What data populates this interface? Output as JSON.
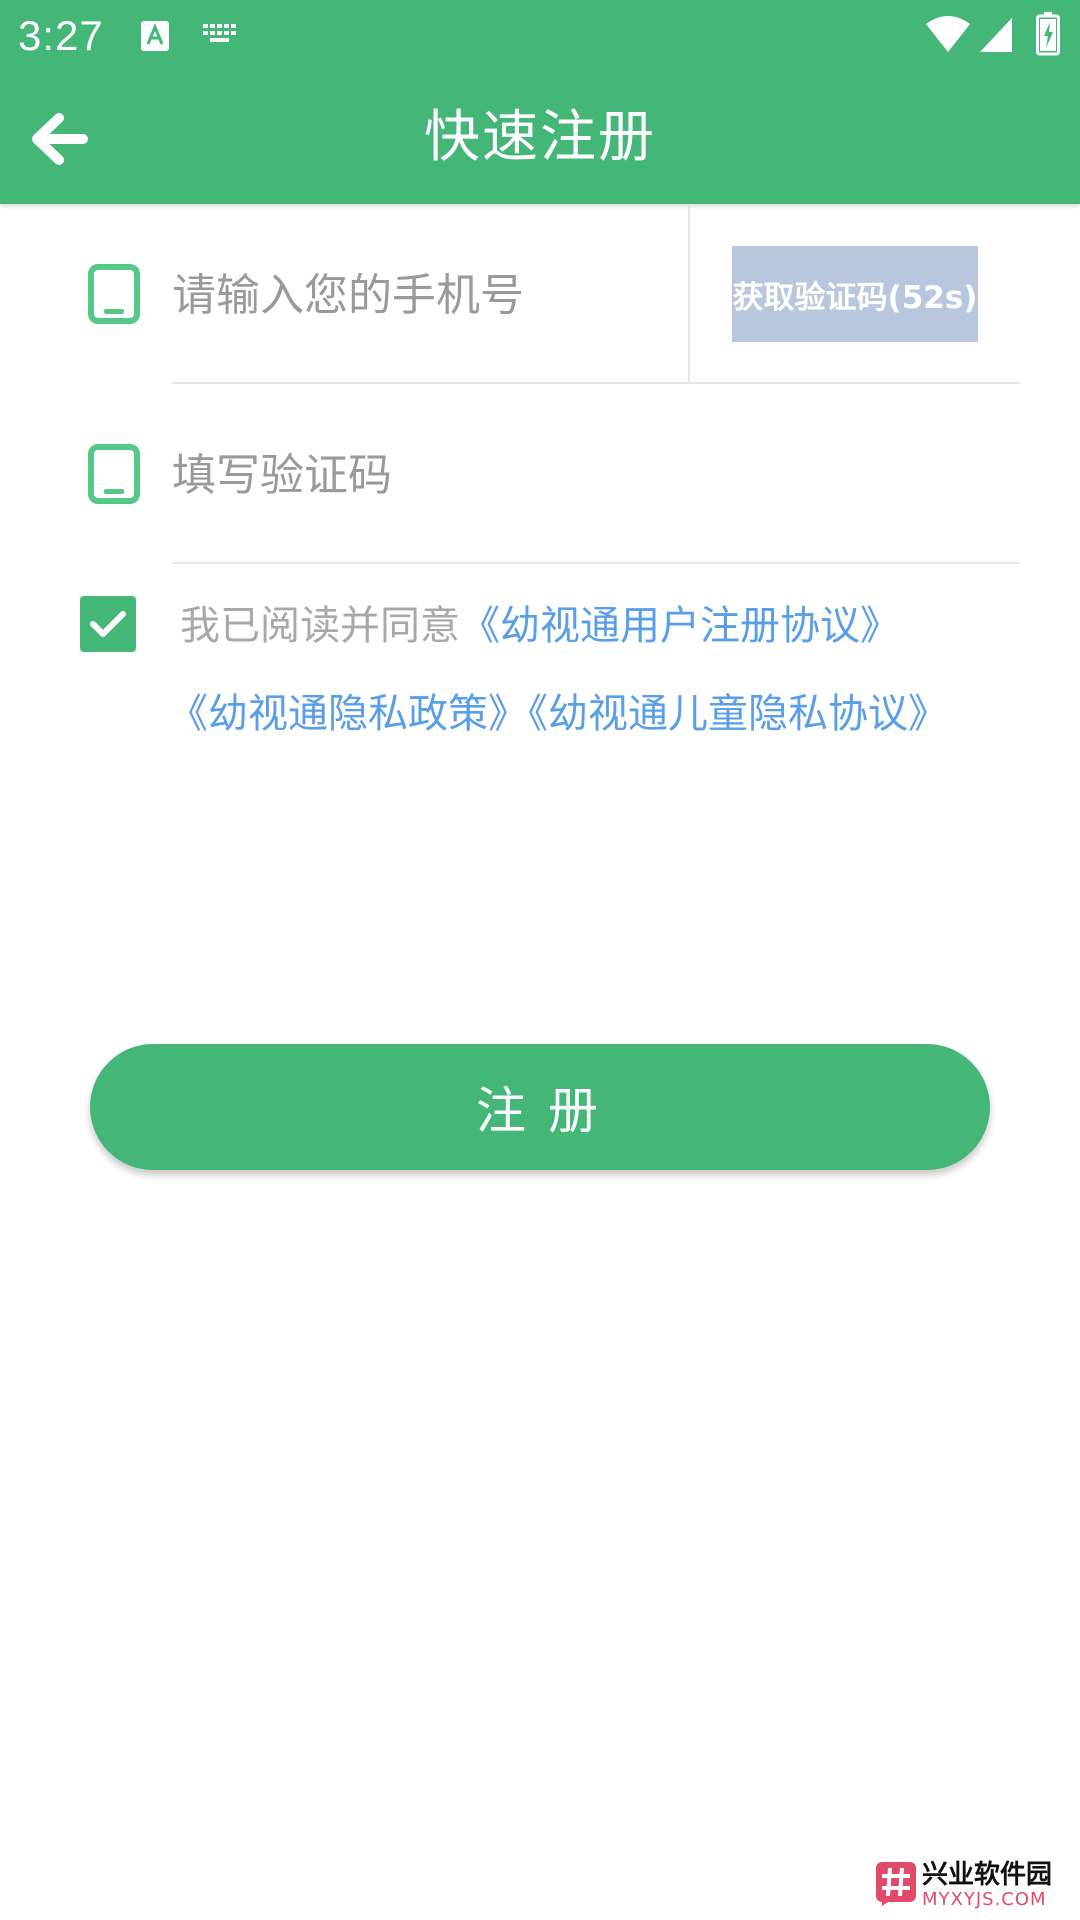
{
  "status_bar": {
    "time": "3:27",
    "icons": [
      "text-input-a-icon",
      "keyboard-icon",
      "wifi-icon",
      "cell-signal-icon",
      "battery-charging-icon"
    ]
  },
  "app_bar": {
    "title": "快速注册",
    "back_icon": "back-arrow-icon"
  },
  "form": {
    "phone": {
      "placeholder": "请输入您的手机号",
      "value": "",
      "icon": "phone-icon"
    },
    "get_code_button": {
      "label": "获取验证码(52s)"
    },
    "code": {
      "placeholder": "填写验证码",
      "value": "",
      "icon": "phone-icon"
    }
  },
  "agreement": {
    "checked": true,
    "prefix": "我已阅读并同意",
    "link_user": "《幼视通用户注册协议》",
    "link_privacy": "《幼视通隐私政策》",
    "link_child": "《幼视通儿童隐私协议》"
  },
  "register_button": {
    "label": "注册"
  },
  "watermark": {
    "title": "兴业软件园",
    "subtitle": "MYXYJS.COM"
  },
  "colors": {
    "primary": "#44b677",
    "link": "#5a9ee8",
    "disabled_button": "#b8c7dd",
    "placeholder": "#9a9a9a"
  }
}
